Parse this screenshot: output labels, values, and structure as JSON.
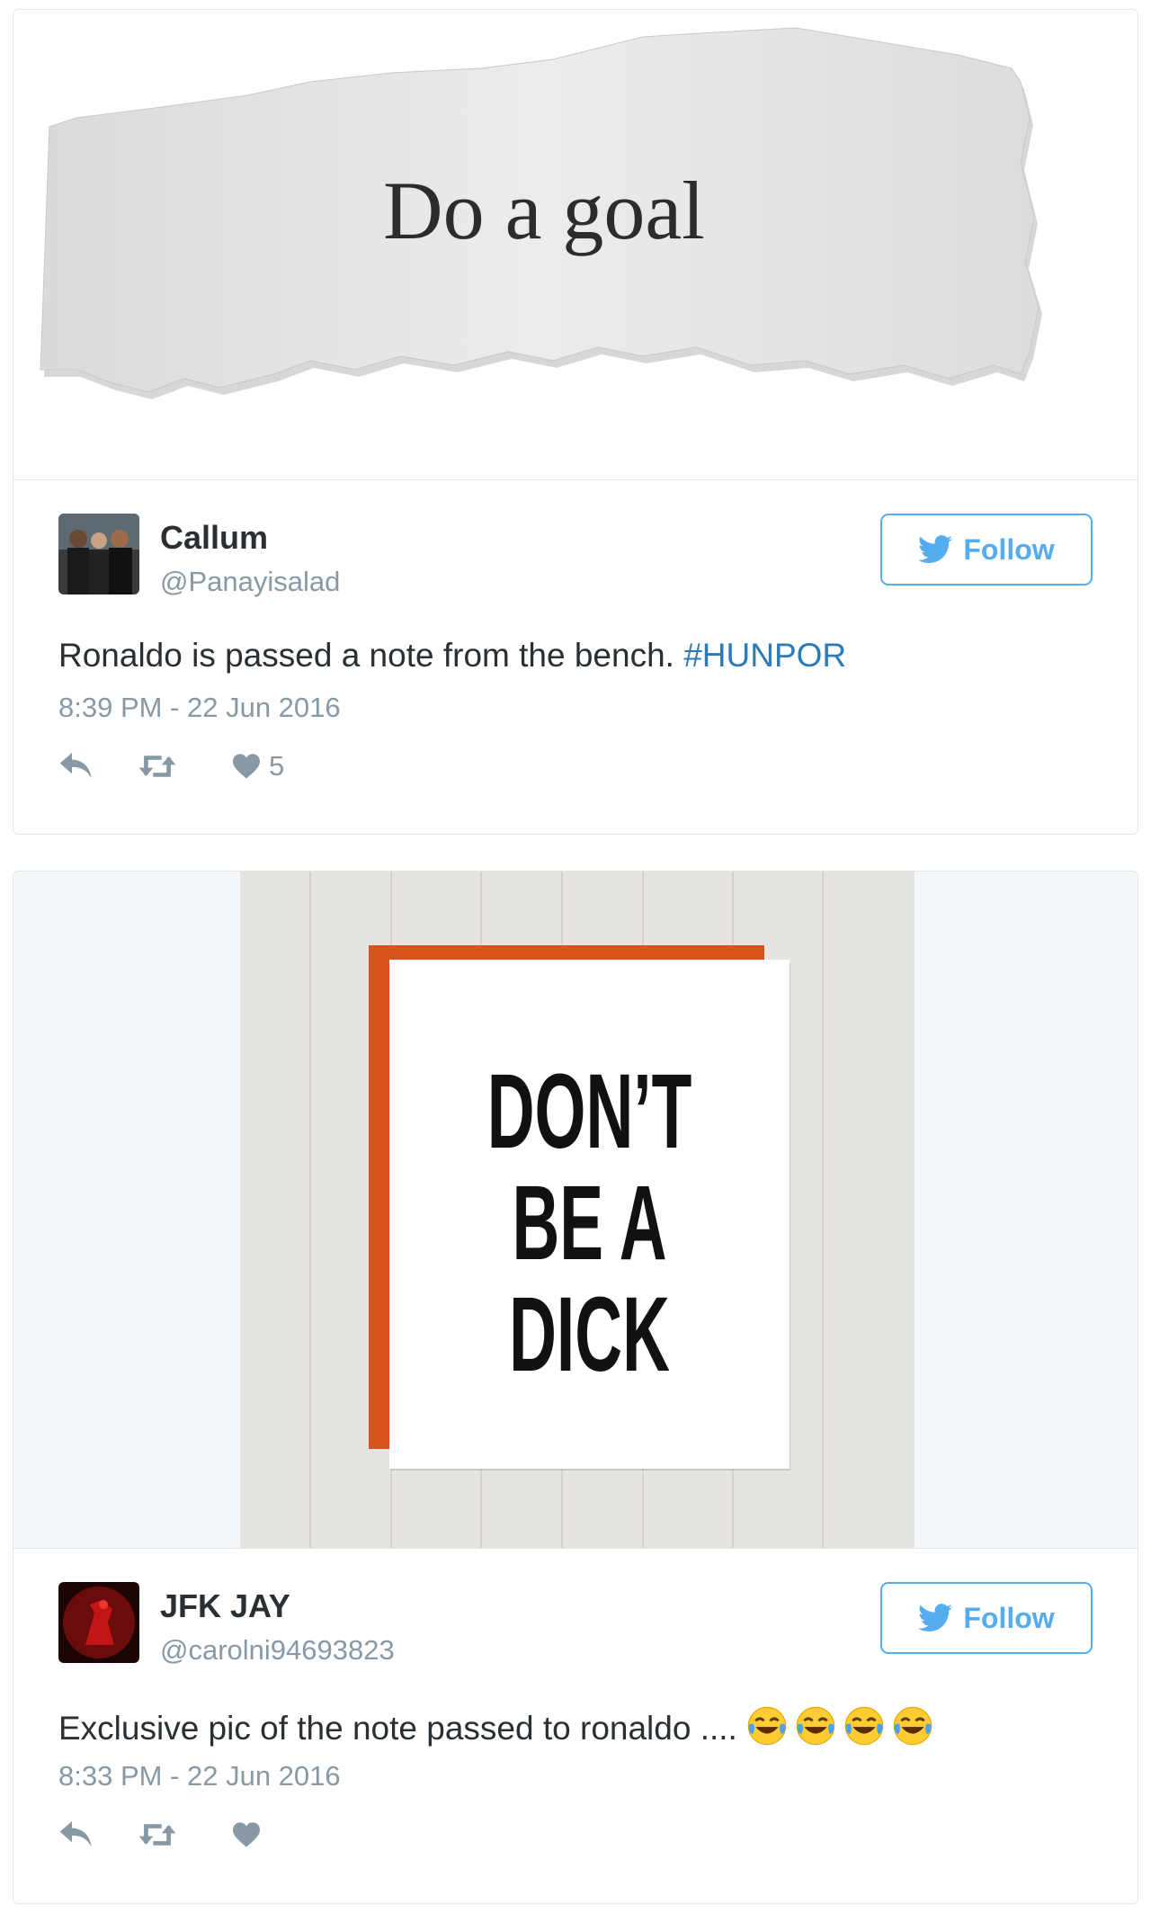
{
  "tweets": [
    {
      "media_text": "Do a goal",
      "name": "Callum",
      "handle": "@Panayisalad",
      "follow_label": "Follow",
      "text": "Ronaldo is passed a note from the bench. ",
      "hashtag": "#HUNPOR",
      "time": "8:39 PM - 22 Jun 2016",
      "likes": "5"
    },
    {
      "media_text_lines": [
        "DON’T",
        "BE A",
        "DICK"
      ],
      "name": "JFK JAY",
      "handle": "@carolni94693823",
      "follow_label": "Follow",
      "text": "Exclusive pic of the note passed to ronaldo ....",
      "emoji": [
        "face-with-tears-of-joy",
        "face-with-tears-of-joy",
        "face-with-tears-of-joy",
        "face-with-tears-of-joy"
      ],
      "time": "8:33 PM - 22 Jun 2016",
      "likes": ""
    }
  ],
  "colors": {
    "accent": "#55acee",
    "hashtag": "#2b7bb9",
    "muted": "#8899a6",
    "text": "#292f33",
    "card_orange": "#d9531e"
  },
  "icons": [
    "twitter-bird-icon",
    "reply-icon",
    "retweet-icon",
    "heart-icon"
  ]
}
